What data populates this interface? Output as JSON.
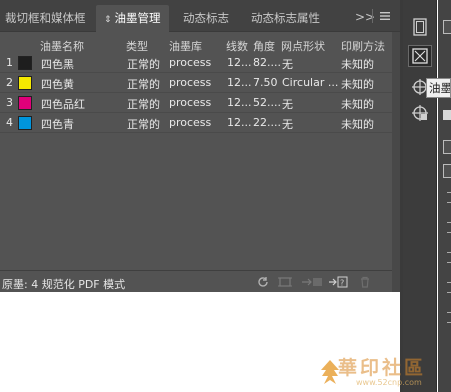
{
  "tabs": [
    {
      "label": "裁切框和媒体框",
      "active": false
    },
    {
      "label": "油墨管理",
      "active": true
    },
    {
      "label": "动态标志",
      "active": false
    },
    {
      "label": "动态标志属性",
      "active": false
    }
  ],
  "tab_overflow": ">>",
  "columns": {
    "name": "油墨名称",
    "type": "类型",
    "library": "油墨库",
    "lines": "线数",
    "angle": "角度",
    "dot_shape": "网点形状",
    "print_method": "印刷方法"
  },
  "inks": [
    {
      "index": "1",
      "swatch": "#1e1e1e",
      "name": "四色黑",
      "type": "正常的",
      "library": "process",
      "lines": "12...",
      "angle": "82....",
      "dot_shape": "无",
      "print_method": "未知的"
    },
    {
      "index": "2",
      "swatch": "#f5e900",
      "name": "四色黄",
      "type": "正常的",
      "library": "process",
      "lines": "12...",
      "angle": "7.50",
      "dot_shape": "Circular ...",
      "print_method": "未知的"
    },
    {
      "index": "3",
      "swatch": "#e0007a",
      "name": "四色品红",
      "type": "正常的",
      "library": "process",
      "lines": "12...",
      "angle": "52....",
      "dot_shape": "无",
      "print_method": "未知的"
    },
    {
      "index": "4",
      "swatch": "#0095dd",
      "name": "四色青",
      "type": "正常的",
      "library": "process",
      "lines": "12...",
      "angle": "22....",
      "dot_shape": "无",
      "print_method": "未知的"
    }
  ],
  "footer": {
    "info": "原墨: 4   规范化 PDF 模式"
  },
  "tooltip": "油墨",
  "watermark": {
    "text": "華印社區",
    "url": "www.52cnp.com"
  },
  "colors": {
    "panel_bg": "#535353",
    "tabbar_bg": "#424242",
    "toolstrip_bg": "#3c3c3c"
  }
}
